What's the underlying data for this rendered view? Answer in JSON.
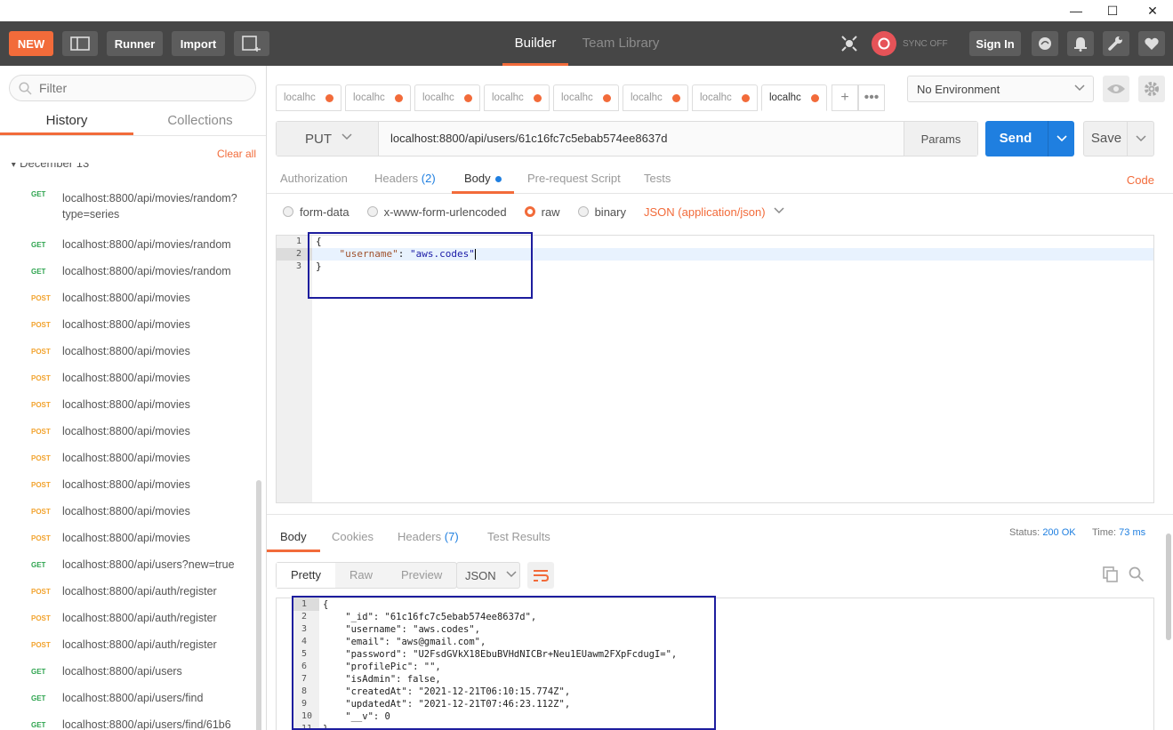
{
  "window": {
    "minimize": "—",
    "maximize": "☐",
    "close": "✕"
  },
  "header": {
    "new_label": "NEW",
    "runner_label": "Runner",
    "import_label": "Import",
    "tab_builder": "Builder",
    "tab_team_library": "Team Library",
    "sync_label": "SYNC OFF",
    "signin_label": "Sign In"
  },
  "sidebar": {
    "filter_placeholder": "Filter",
    "tab_history": "History",
    "tab_collections": "Collections",
    "clear_all": "Clear all",
    "group_date": "December 13",
    "items": [
      {
        "method": "GET",
        "url": "localhost:8800/api/movies/random?type=series"
      },
      {
        "method": "GET",
        "url": "localhost:8800/api/movies/random"
      },
      {
        "method": "GET",
        "url": "localhost:8800/api/movies/random"
      },
      {
        "method": "POST",
        "url": "localhost:8800/api/movies"
      },
      {
        "method": "POST",
        "url": "localhost:8800/api/movies"
      },
      {
        "method": "POST",
        "url": "localhost:8800/api/movies"
      },
      {
        "method": "POST",
        "url": "localhost:8800/api/movies"
      },
      {
        "method": "POST",
        "url": "localhost:8800/api/movies"
      },
      {
        "method": "POST",
        "url": "localhost:8800/api/movies"
      },
      {
        "method": "POST",
        "url": "localhost:8800/api/movies"
      },
      {
        "method": "POST",
        "url": "localhost:8800/api/movies"
      },
      {
        "method": "POST",
        "url": "localhost:8800/api/movies"
      },
      {
        "method": "POST",
        "url": "localhost:8800/api/movies"
      },
      {
        "method": "GET",
        "url": "localhost:8800/api/users?new=true"
      },
      {
        "method": "POST",
        "url": "localhost:8800/api/auth/register"
      },
      {
        "method": "POST",
        "url": "localhost:8800/api/auth/register"
      },
      {
        "method": "POST",
        "url": "localhost:8800/api/auth/register"
      },
      {
        "method": "GET",
        "url": "localhost:8800/api/users"
      },
      {
        "method": "GET",
        "url": "localhost:8800/api/users/find"
      },
      {
        "method": "GET",
        "url": "localhost:8800/api/users/find/61b6"
      }
    ]
  },
  "request_tabs": [
    "localhc",
    "localhc",
    "localhc",
    "localhc",
    "localhc",
    "localhc",
    "localhc",
    "localhc"
  ],
  "environment": {
    "selected": "No Environment"
  },
  "request": {
    "method": "PUT",
    "url": "localhost:8800/api/users/61c16fc7c5ebab574ee8637d",
    "params_label": "Params",
    "send_label": "Send",
    "save_label": "Save"
  },
  "request_subtabs": {
    "authorization": "Authorization",
    "headers": "Headers",
    "headers_count": "(2)",
    "body": "Body",
    "prerequest": "Pre-request Script",
    "tests": "Tests",
    "code": "Code"
  },
  "body_options": {
    "form_data": "form-data",
    "urlencoded": "x-www-form-urlencoded",
    "raw": "raw",
    "binary": "binary",
    "content_type": "JSON (application/json)"
  },
  "request_body": {
    "line_numbers": [
      "1",
      "2",
      "3"
    ],
    "line1": "{",
    "line2_key": "\"username\"",
    "line2_sep": ": ",
    "line2_val": "\"aws.codes\"",
    "line3": "}"
  },
  "response_tabs": {
    "body": "Body",
    "cookies": "Cookies",
    "headers": "Headers",
    "headers_count": "(7)",
    "test_results": "Test Results"
  },
  "response_status": {
    "status_label": "Status:",
    "status_value": "200 OK",
    "time_label": "Time:",
    "time_value": "73 ms"
  },
  "response_view": {
    "pretty": "Pretty",
    "raw": "Raw",
    "preview": "Preview",
    "format": "JSON"
  },
  "response_body": {
    "line_numbers": [
      "1",
      "2",
      "3",
      "4",
      "5",
      "6",
      "7",
      "8",
      "9",
      "10",
      "11"
    ],
    "lines": [
      "{",
      "    \"_id\": \"61c16fc7c5ebab574ee8637d\",",
      "    \"username\": \"aws.codes\",",
      "    \"email\": \"aws@gmail.com\",",
      "    \"password\": \"U2FsdGVkX18EbuBVHdNICBr+Neu1EUawm2FXpFcdugI=\",",
      "    \"profilePic\": \"\",",
      "    \"isAdmin\": false,",
      "    \"createdAt\": \"2021-12-21T06:10:15.774Z\",",
      "    \"updatedAt\": \"2021-12-21T07:46:23.112Z\",",
      "    \"__v\": 0",
      "}"
    ]
  },
  "colors": {
    "accent": "#f26b3a",
    "send": "#1f7fe0",
    "get": "#2ea44f",
    "post": "#f2a32e",
    "highlight_box": "#1d1d9e"
  }
}
